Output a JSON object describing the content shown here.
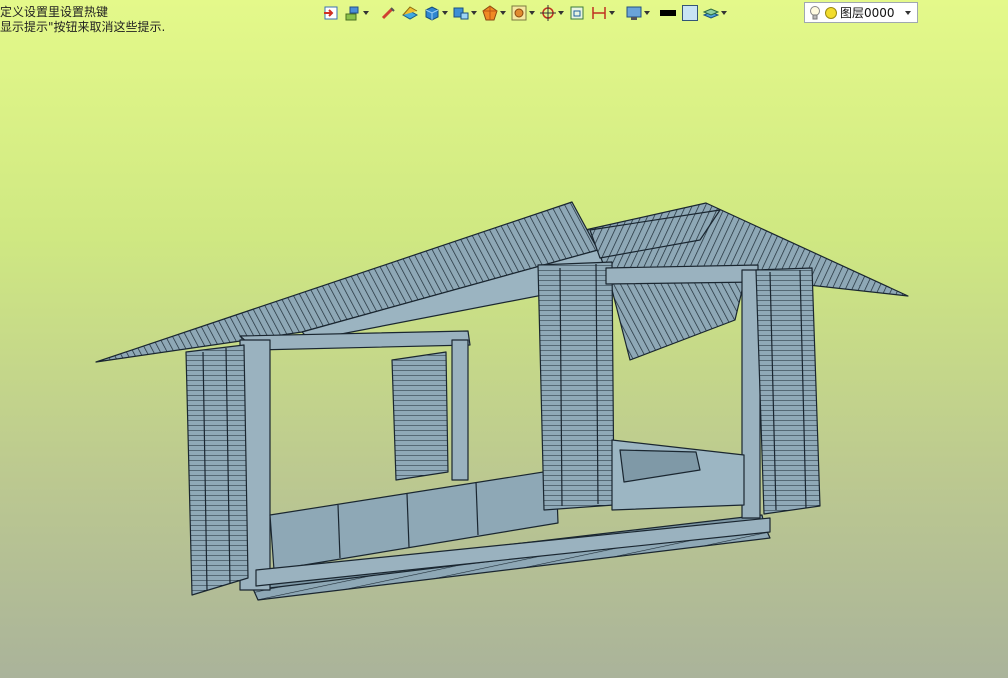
{
  "hint": {
    "line1": "定义设置里设置热键",
    "line2": "显示提示\"按钮来取消这些提示."
  },
  "toolbar": {
    "items": [
      {
        "icon": "insert-icon"
      },
      {
        "icon": "features-icon"
      },
      {
        "icon": "sketch-icon"
      },
      {
        "icon": "surface-icon"
      },
      {
        "icon": "solid-icon"
      },
      {
        "icon": "view-orient-icon"
      },
      {
        "icon": "render-icon"
      },
      {
        "icon": "section-icon"
      },
      {
        "icon": "snap-icon"
      },
      {
        "icon": "measure-icon"
      },
      {
        "icon": "dimension-icon"
      },
      {
        "icon": "display-icon"
      },
      {
        "icon": "line-color-icon"
      },
      {
        "icon": "face-color-icon"
      },
      {
        "icon": "layers-icon"
      }
    ]
  },
  "layer": {
    "name": "图层0000"
  },
  "colors": {
    "model_fill": "#8ea8b6",
    "model_line": "#1a2630",
    "bg_top": "#e4f98a",
    "bg_bottom": "#aab39a"
  }
}
